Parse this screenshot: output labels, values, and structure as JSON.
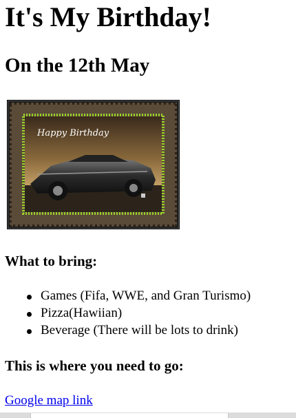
{
  "header": {
    "title": "It's My Birthday!",
    "date_line": "On the 12th May"
  },
  "card": {
    "text": "Happy Birthday",
    "icon": "birthday-car-card-image"
  },
  "bring": {
    "heading": "What to bring:",
    "items": [
      "Games (Fifa, WWE, and Gran Turismo)",
      "Pizza(Hawiian)",
      "Beverage (There will be lots to drink)"
    ]
  },
  "directions": {
    "heading": "This is where you need to go:",
    "link_label": "Google map link"
  },
  "colors": {
    "link": "#0000ee",
    "card_border_glow": "#9bd22a",
    "scrollbar_track": "#dcdcdc"
  }
}
